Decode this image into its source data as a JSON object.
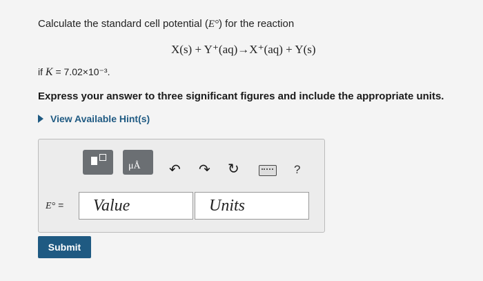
{
  "question": {
    "prefix": "Calculate the standard cell potential (",
    "symbol": "E°",
    "suffix": ") for the reaction"
  },
  "reaction": "X(s) + Y⁺(aq)→X⁺(aq) + Y(s)",
  "condition": {
    "prefix": "if ",
    "var": "K",
    "value": " = 7.02×10⁻³."
  },
  "instruction": "Express your answer to three significant figures and include the appropriate units.",
  "hint": {
    "label": "View Available Hint(s)"
  },
  "toolbar": {
    "btn2_text": "μÅ",
    "help": "?"
  },
  "answer": {
    "label": "E°",
    "eq": "=",
    "value_placeholder": "Value",
    "units_placeholder": "Units"
  },
  "submit_label": "Submit"
}
